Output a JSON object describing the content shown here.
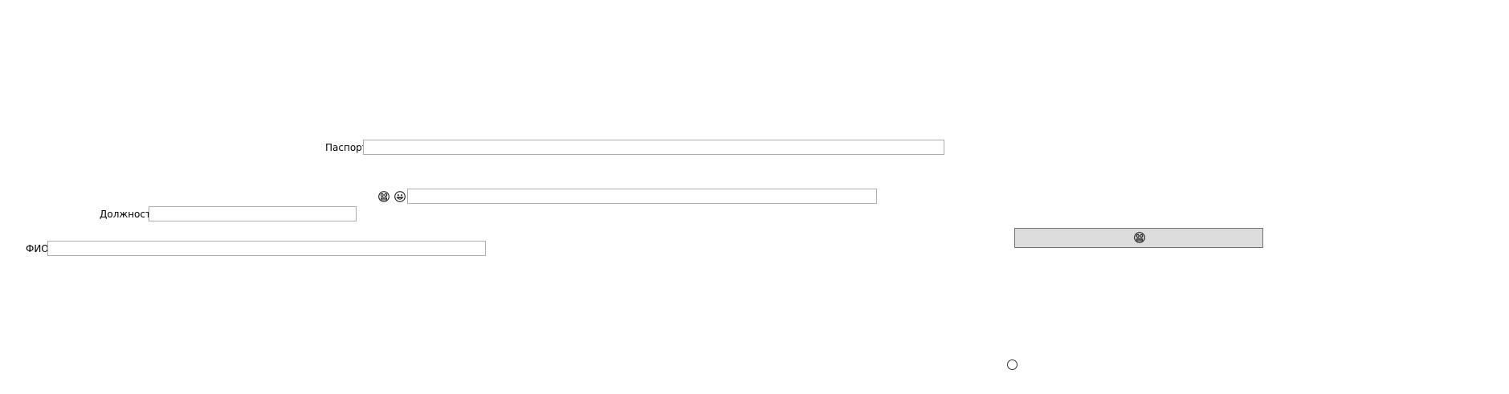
{
  "form": {
    "passport": {
      "label": "Паспорт",
      "value": ""
    },
    "emoji_field": {
      "icons": [
        "grimacing-face-icon",
        "grinning-face-icon"
      ],
      "value": ""
    },
    "position": {
      "label": "Должность",
      "value": ""
    },
    "full_name": {
      "label": "ФИО",
      "value": ""
    },
    "submit_button": {
      "icon": "grimacing-face-icon"
    },
    "radio": {
      "checked": false
    }
  }
}
